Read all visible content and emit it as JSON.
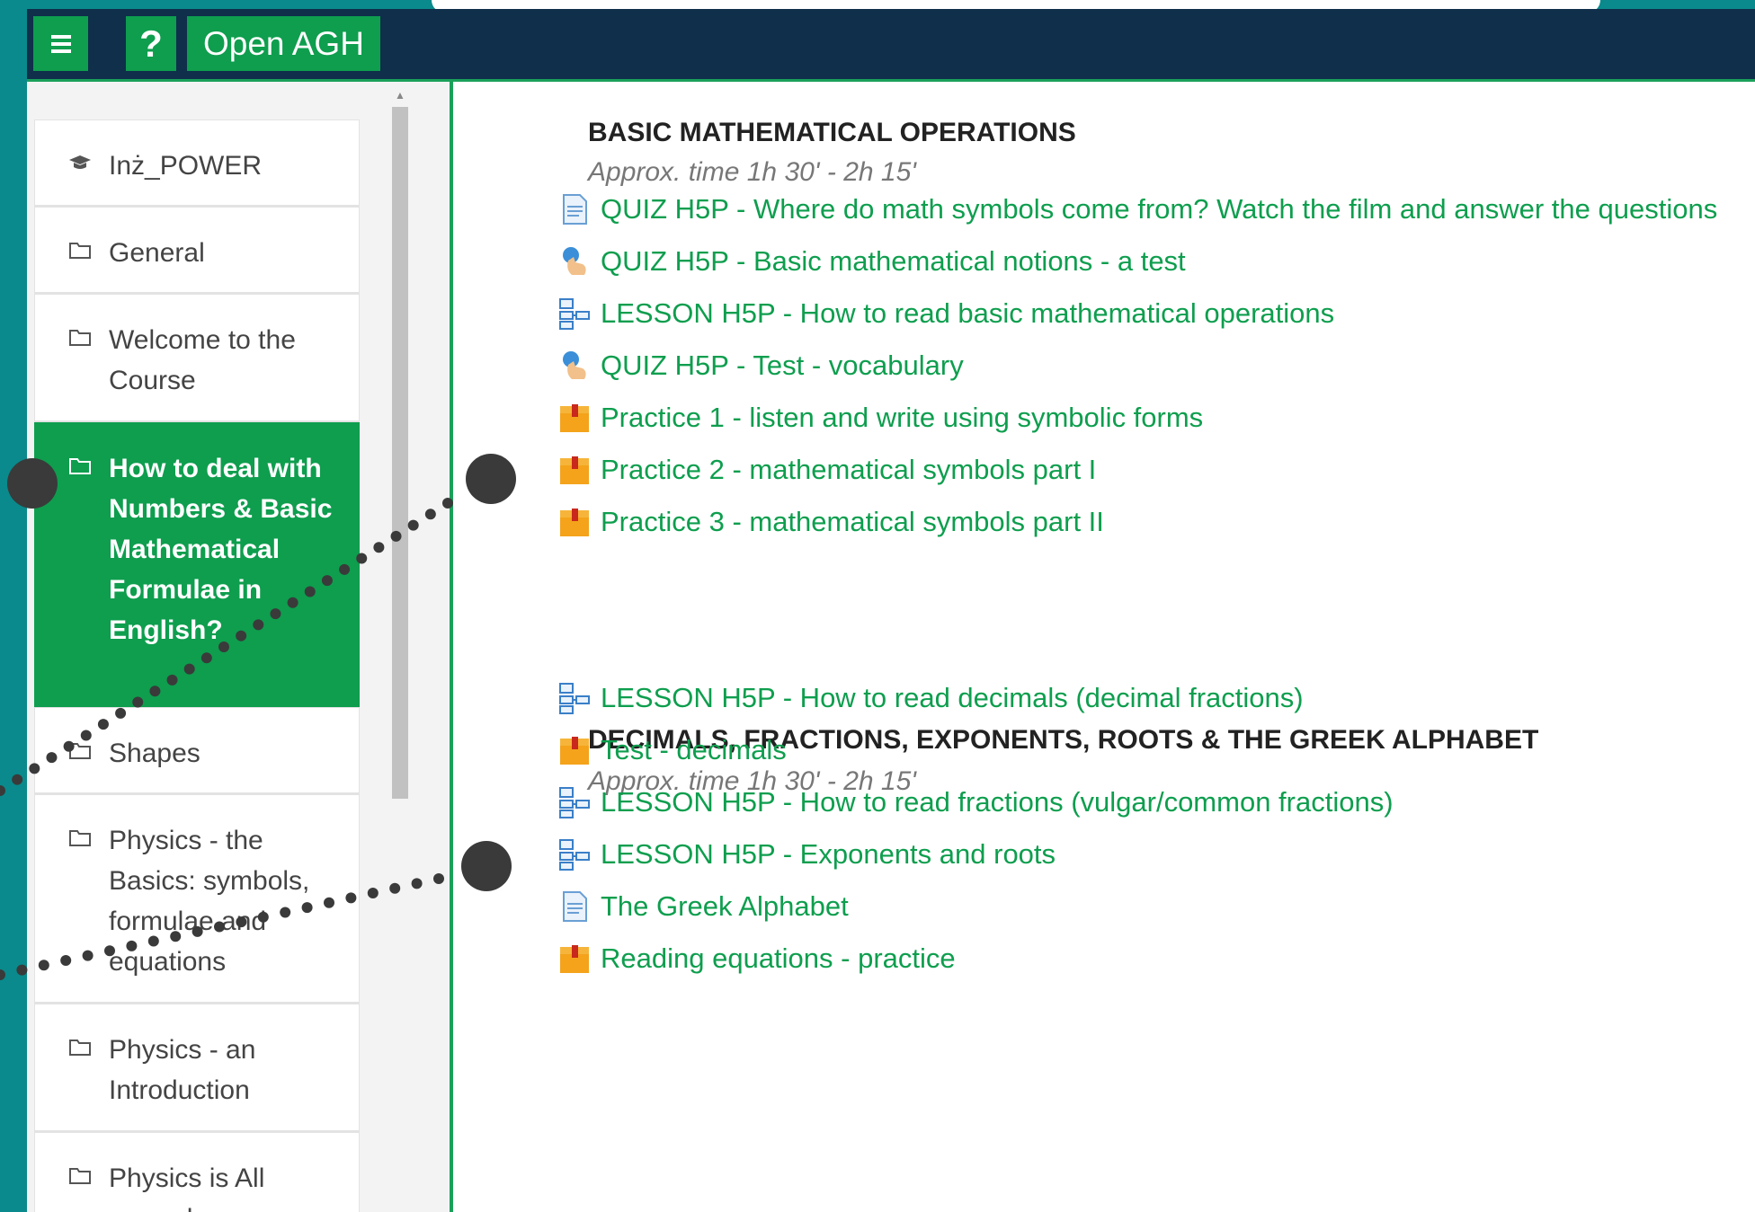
{
  "navbar": {
    "menu_icon": "hamburger-icon",
    "help_label": "?",
    "brand": "Open AGH"
  },
  "sidebar": {
    "items": [
      {
        "label": "Inż_POWER",
        "icon": "graduation-cap-icon"
      },
      {
        "label": "General",
        "icon": "folder-icon"
      },
      {
        "label": "Welcome to the Course",
        "icon": "folder-icon"
      },
      {
        "label": "How to deal with Numbers & Basic Mathematical Formulae in English?",
        "icon": "folder-icon",
        "active": true
      },
      {
        "label": "Shapes",
        "icon": "folder-icon"
      },
      {
        "label": "Physics - the Basics: symbols, formulae and equations",
        "icon": "folder-icon"
      },
      {
        "label": "Physics - an Introduction",
        "icon": "folder-icon"
      },
      {
        "label": "Physics is All around us",
        "icon": "folder-icon"
      }
    ]
  },
  "sections": [
    {
      "title": "BASIC MATHEMATICAL OPERATIONS",
      "time": "Approx. time 1h 30' - 2h 15'",
      "activities": [
        {
          "label": "QUIZ H5P - Where do math symbols come from? Watch the film and answer the questions",
          "icon": "page-icon"
        },
        {
          "label": "QUIZ H5P - Basic mathematical notions - a test",
          "icon": "interactive-quiz-icon"
        },
        {
          "label": "LESSON H5P - How to read basic mathematical operations",
          "icon": "lesson-icon"
        },
        {
          "label": "QUIZ H5P - Test - vocabulary",
          "icon": "interactive-quiz-icon"
        },
        {
          "label": "Practice 1 - listen and write using symbolic forms",
          "icon": "package-icon"
        },
        {
          "label": "Practice 2 - mathematical symbols part I",
          "icon": "package-icon"
        },
        {
          "label": "Practice 3 - mathematical symbols part II",
          "icon": "package-icon"
        }
      ]
    },
    {
      "title": "DECIMALS, FRACTIONS, EXPONENTS, ROOTS & THE GREEK ALPHABET",
      "time": "Approx. time 1h 30' - 2h 15'",
      "activities": [
        {
          "label": "LESSON H5P - How to read decimals (decimal fractions)",
          "icon": "lesson-icon"
        },
        {
          "label": "Test - decimals",
          "icon": "package-icon"
        },
        {
          "label": "LESSON H5P - How to read fractions (vulgar/common fractions)",
          "icon": "lesson-icon"
        },
        {
          "label": "LESSON H5P - Exponents and roots",
          "icon": "lesson-icon"
        },
        {
          "label": "The Greek Alphabet",
          "icon": "page-icon"
        },
        {
          "label": "Reading equations - practice",
          "icon": "package-icon"
        }
      ]
    }
  ],
  "colors": {
    "navbar": "#0f2f4b",
    "accent_green": "#0e9e4e",
    "background_teal": "#0a8a8c",
    "link_green": "#0e9e4e"
  }
}
